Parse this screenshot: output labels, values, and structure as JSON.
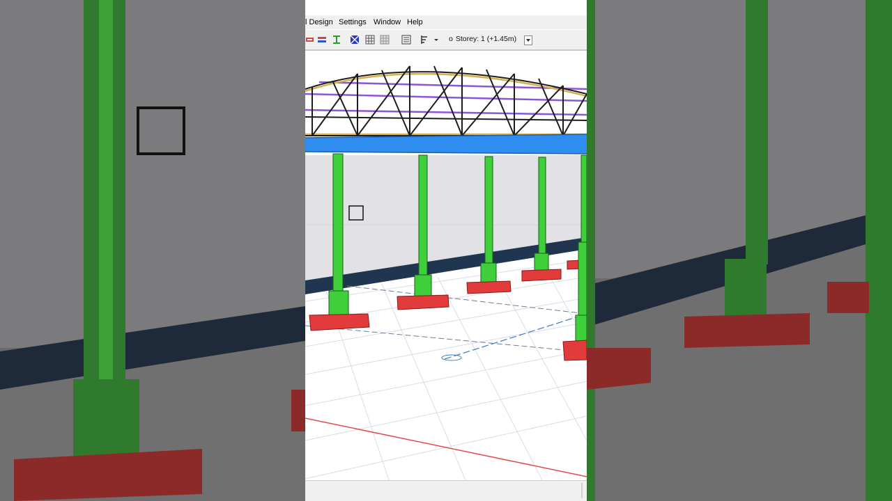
{
  "menu": {
    "design": "l Design",
    "settings": "Settings",
    "window": "Window",
    "help": "Help"
  },
  "toolbar": {
    "storey_label": "Storey: 1 (+1.45m)"
  },
  "icons": {
    "beam_icon": "beam-icon",
    "column_icon": "column-icon",
    "grid_icon": "grid-icon"
  },
  "colors": {
    "column": "#3fcf3a",
    "footing": "#e13b3b",
    "beam": "#2f8df0",
    "truss": "#1d1d1d",
    "purlin": "#8a55d6",
    "grid_axis": "#e04b4b"
  }
}
